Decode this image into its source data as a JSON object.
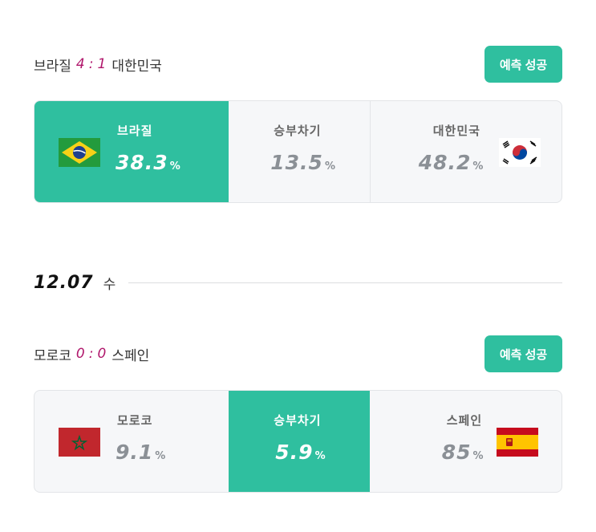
{
  "match1": {
    "team1": "브라질",
    "score1": "4",
    "score_sep": ":",
    "score2": "1",
    "team2": "대한민국",
    "badge": "예측 성공",
    "options": [
      {
        "label": "브라질",
        "value": "38.3",
        "unit": "%",
        "flag": "brazil-flag-icon",
        "selected": true
      },
      {
        "label": "승부차기",
        "value": "13.5",
        "unit": "%",
        "selected": false
      },
      {
        "label": "대한민국",
        "value": "48.2",
        "unit": "%",
        "flag": "korea-flag-icon",
        "selected": false
      }
    ]
  },
  "date": {
    "date": "12.07",
    "day": "수"
  },
  "match2": {
    "team1": "모로코",
    "score1": "0",
    "score_sep": ":",
    "score2": "0",
    "team2": "스페인",
    "badge": "예측 성공",
    "options": [
      {
        "label": "모로코",
        "value": "9.1",
        "unit": "%",
        "flag": "morocco-flag-icon",
        "selected": false
      },
      {
        "label": "승부차기",
        "value": "5.9",
        "unit": "%",
        "selected": true
      },
      {
        "label": "스페인",
        "value": "85",
        "unit": "%",
        "flag": "spain-flag-icon",
        "selected": false
      }
    ]
  },
  "colors": {
    "accent": "#2fbf9f",
    "score": "#b0166b",
    "muted": "#8b9096"
  }
}
